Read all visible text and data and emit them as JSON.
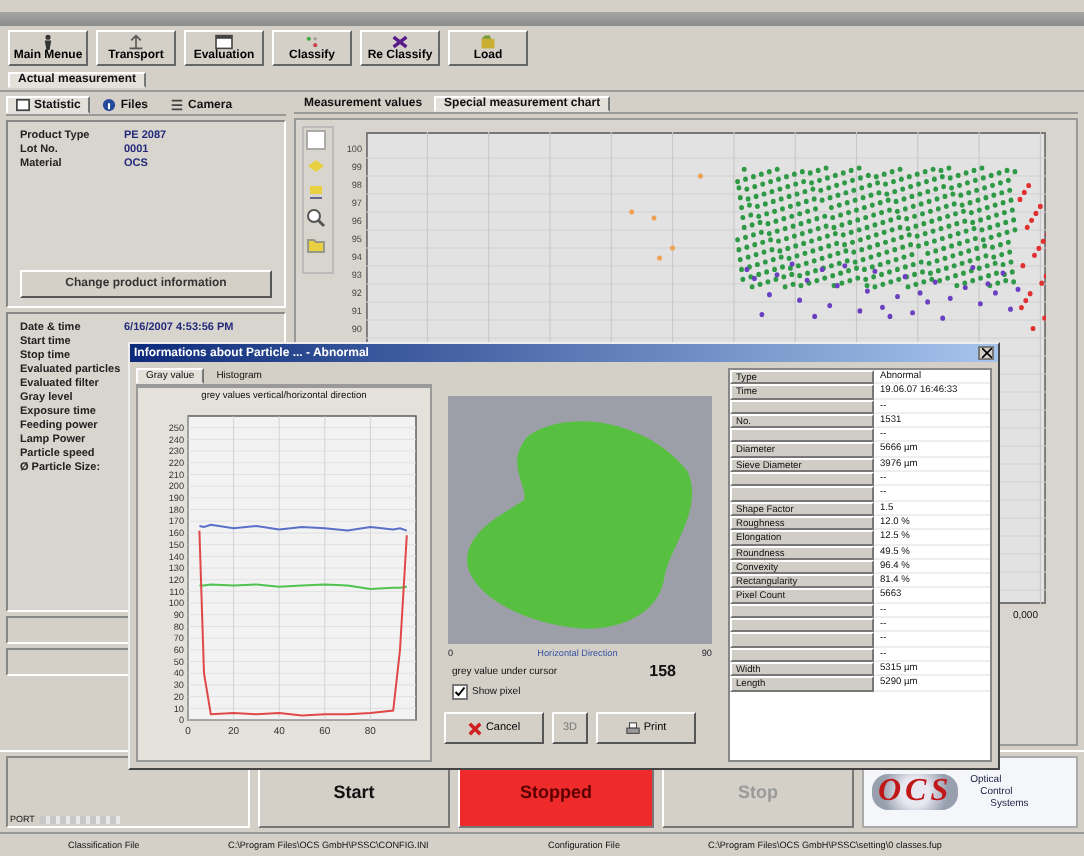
{
  "toolbar": [
    {
      "label": "Main Menue"
    },
    {
      "label": "Transport"
    },
    {
      "label": "Evaluation"
    },
    {
      "label": "Classify"
    },
    {
      "label": "Re Classify"
    },
    {
      "label": "Load"
    }
  ],
  "main_tabs": [
    {
      "label": "Actual measurement",
      "selected": true
    }
  ],
  "left_tabs": [
    {
      "label": "Statistic",
      "selected": true
    },
    {
      "label": "Files",
      "selected": false
    },
    {
      "label": "Camera",
      "selected": false
    }
  ],
  "product": [
    {
      "label": "Product Type",
      "value": "PE 2087"
    },
    {
      "label": "Lot No.",
      "value": "0001"
    },
    {
      "label": "Material",
      "value": "OCS"
    }
  ],
  "change_button": "Change product information",
  "info": [
    {
      "label": "Date & time",
      "value": "6/16/2007 4:53:56 PM"
    },
    {
      "label": "Start time"
    },
    {
      "label": "Stop time"
    },
    {
      "label": "Evaluated particles"
    },
    {
      "label": "Evaluated filter"
    },
    {
      "label": "Gray level"
    },
    {
      "label": "Exposure time"
    },
    {
      "label": "Feeding power"
    },
    {
      "label": "Lamp Power"
    },
    {
      "label": "Particle speed"
    },
    {
      "label": "Ø Particle Size:"
    }
  ],
  "chart_tabs": [
    {
      "label": "Measurement values",
      "selected": false
    },
    {
      "label": "Special measurement chart",
      "selected": true
    }
  ],
  "scatter": {
    "y_labels": [
      "100",
      "99",
      "98",
      "97",
      "96",
      "95",
      "94",
      "93",
      "92",
      "91",
      "90"
    ],
    "x_labels": [
      "0,000"
    ]
  },
  "dialog": {
    "title": "Informations about Particle ... - Abnormal",
    "tabs": [
      {
        "label": "Gray value",
        "selected": true
      },
      {
        "label": "Histogram",
        "selected": false
      }
    ],
    "chart_data": {
      "type": "line",
      "grid": true,
      "title": "grey values vertical/horizontal direction",
      "x": [
        5,
        7,
        10,
        20,
        30,
        40,
        50,
        60,
        70,
        80,
        90,
        93,
        96
      ],
      "series": [
        {
          "color": "#5a6fc8",
          "values": [
            166,
            165,
            167,
            164,
            166,
            163,
            165,
            164,
            162,
            165,
            163,
            164,
            162
          ]
        },
        {
          "color": "#4fc24f",
          "values": [
            115,
            115,
            116,
            115,
            116,
            114,
            115,
            116,
            115,
            112,
            113,
            113,
            114
          ]
        },
        {
          "color": "#e04848",
          "values": [
            162,
            40,
            5,
            6,
            5,
            6,
            4,
            5,
            5,
            6,
            8,
            60,
            158
          ]
        }
      ],
      "xlim": [
        0,
        100
      ],
      "ylim": [
        0,
        260
      ],
      "xticks": [
        0,
        20,
        40,
        60,
        80
      ],
      "yticks": [
        0,
        10,
        20,
        30,
        40,
        50,
        60,
        70,
        80,
        90,
        100,
        110,
        120,
        130,
        140,
        150,
        160,
        170,
        180,
        190,
        200,
        210,
        220,
        230,
        240,
        250
      ]
    },
    "image_axis": {
      "start": "0",
      "label": "Horizontal Direction",
      "end": "90"
    },
    "cursor_label": "grey value under cursor",
    "cursor_value": "158",
    "show_pixel": {
      "label": "Show pixel",
      "checked": true
    },
    "buttons": [
      {
        "label": "Cancel",
        "kind": "cancel"
      },
      {
        "label": "3D",
        "kind": "plain"
      },
      {
        "label": "Print",
        "kind": "print"
      }
    ],
    "properties": [
      {
        "label": "Type",
        "value": "Abnormal"
      },
      {
        "label": "Time",
        "value": "19.06.07 16:46:33"
      },
      {
        "value": "--"
      },
      {
        "label": "No.",
        "value": "1531"
      },
      {
        "value": "--"
      },
      {
        "label": "Diameter",
        "value": "5666 µm"
      },
      {
        "label": "Sieve Diameter",
        "value": "3976 µm"
      },
      {
        "value": "--"
      },
      {
        "value": "--"
      },
      {
        "label": "Shape Factor",
        "value": "1.5"
      },
      {
        "label": "Roughness",
        "value": "12.0 %"
      },
      {
        "label": "Elongation",
        "value": "12.5 %"
      },
      {
        "label": "Roundness",
        "value": "49.5 %"
      },
      {
        "label": "Convexity",
        "value": "96.4 %"
      },
      {
        "label": "Rectangularity",
        "value": "81.4 %"
      },
      {
        "label": "Pixel Count",
        "value": "5663"
      },
      {
        "value": "--"
      },
      {
        "value": "--"
      },
      {
        "value": "--"
      },
      {
        "value": "--"
      },
      {
        "label": "Width",
        "value": "5315 µm"
      },
      {
        "label": "Length",
        "value": "5290 µm"
      }
    ]
  },
  "port_label": "PORT",
  "controls": [
    {
      "label": "Start",
      "kind": "start",
      "disabled": false
    },
    {
      "label": "Stopped",
      "kind": "status"
    },
    {
      "label": "Stop",
      "kind": "stop",
      "disabled": true
    }
  ],
  "logo": {
    "letters": "OCS",
    "tagline": [
      "Optical",
      "Control",
      "Systems"
    ]
  },
  "status_bar": [
    "Classification File",
    "C:\\Program Files\\OCS GmbH\\PSSC\\CONFIG.INI",
    "Configuration File",
    "C:\\Program Files\\OCS GmbH\\PSSC\\setting\\0 classes.fup"
  ]
}
